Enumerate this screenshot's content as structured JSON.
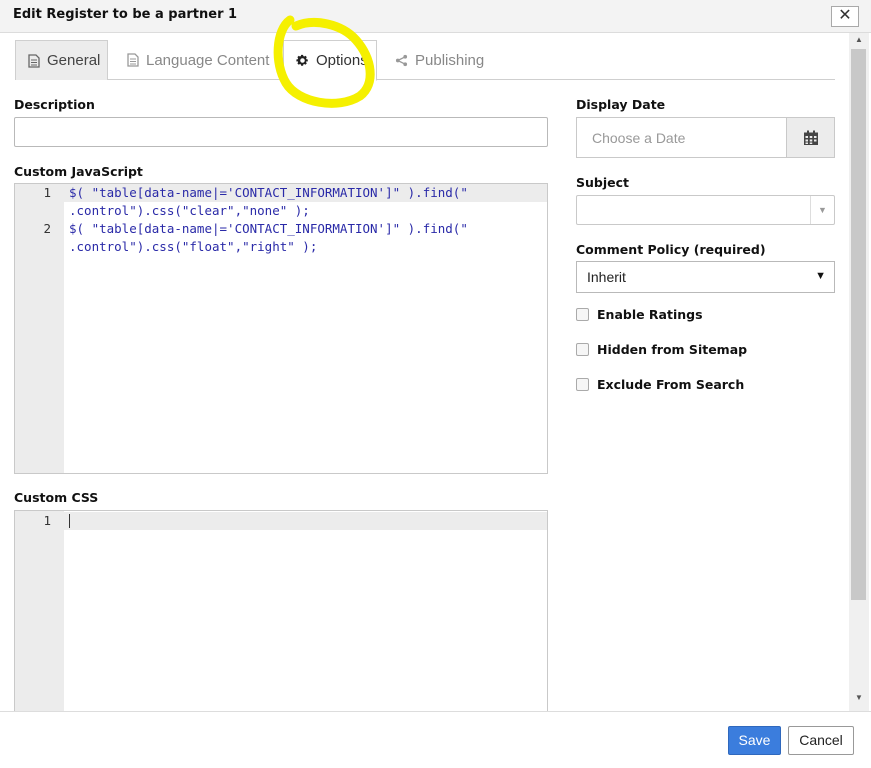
{
  "dialog": {
    "title": "Edit Register to be a partner 1",
    "close_glyph": "✕"
  },
  "tabs": [
    {
      "label": "General",
      "icon": "document-icon",
      "active": false
    },
    {
      "label": "Language Content",
      "icon": "document-icon",
      "active": false
    },
    {
      "label": "Options",
      "icon": "gear-icon",
      "active": true
    },
    {
      "label": "Publishing",
      "icon": "share-icon",
      "active": false
    }
  ],
  "left": {
    "description_label": "Description",
    "description_value": "",
    "custom_js_label": "Custom JavaScript",
    "custom_js_lines": [
      {
        "number": "1",
        "text_a": "$( \"table[data-name|='CONTACT_INFORMATION']\" ).find(\"",
        "text_b": ".control\").css(\"clear\",\"none\" );"
      },
      {
        "number": "2",
        "text_a": "$( \"table[data-name|='CONTACT_INFORMATION']\" ).find(\"",
        "text_b": ".control\").css(\"float\",\"right\" );"
      }
    ],
    "custom_css_label": "Custom CSS",
    "custom_css_lines": [
      {
        "number": "1",
        "text": ""
      }
    ]
  },
  "right": {
    "display_date_label": "Display Date",
    "display_date_placeholder": "Choose a Date",
    "subject_label": "Subject",
    "subject_value": "",
    "comment_policy_label": "Comment Policy (required)",
    "comment_policy_value": "Inherit",
    "checkboxes": [
      {
        "label": "Enable Ratings",
        "checked": false
      },
      {
        "label": "Hidden from Sitemap",
        "checked": false
      },
      {
        "label": "Exclude From Search",
        "checked": false
      }
    ]
  },
  "footer": {
    "save_label": "Save",
    "cancel_label": "Cancel"
  },
  "colors": {
    "primary_button": "#3b7ddd",
    "highlight_annotation": "#f5f000"
  }
}
